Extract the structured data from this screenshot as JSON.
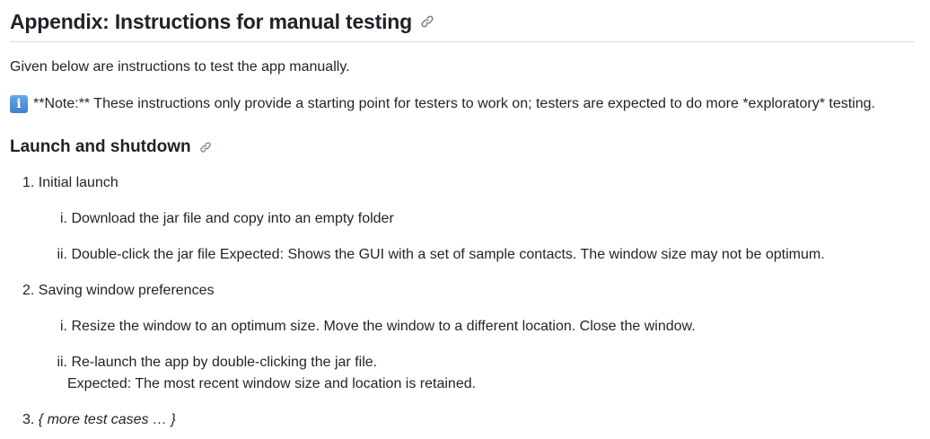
{
  "heading": "Appendix: Instructions for manual testing",
  "intro": "Given below are instructions to test the app manually.",
  "note": {
    "icon": "info-icon",
    "text": "**Note:** These instructions only provide a starting point for testers to work on; testers are expected to do more *exploratory* testing."
  },
  "section": {
    "title": "Launch and shutdown",
    "items": [
      {
        "marker": "1.",
        "text": "Initial launch",
        "subitems": [
          {
            "marker": "i.",
            "text": "Download the jar file and copy into an empty folder"
          },
          {
            "marker": "ii.",
            "text": "Double-click the jar file Expected: Shows the GUI with a set of sample contacts. The window size may not be optimum."
          }
        ]
      },
      {
        "marker": "2.",
        "text": "Saving window preferences",
        "subitems": [
          {
            "marker": "i.",
            "text": "Resize the window to an optimum size. Move the window to a different location. Close the window."
          },
          {
            "marker": "ii.",
            "text": "Re-launch the app by double-clicking the jar file.",
            "continuation": "Expected: The most recent window size and location is retained."
          }
        ]
      },
      {
        "marker": "3.",
        "text": "{ more test cases … }"
      }
    ]
  }
}
